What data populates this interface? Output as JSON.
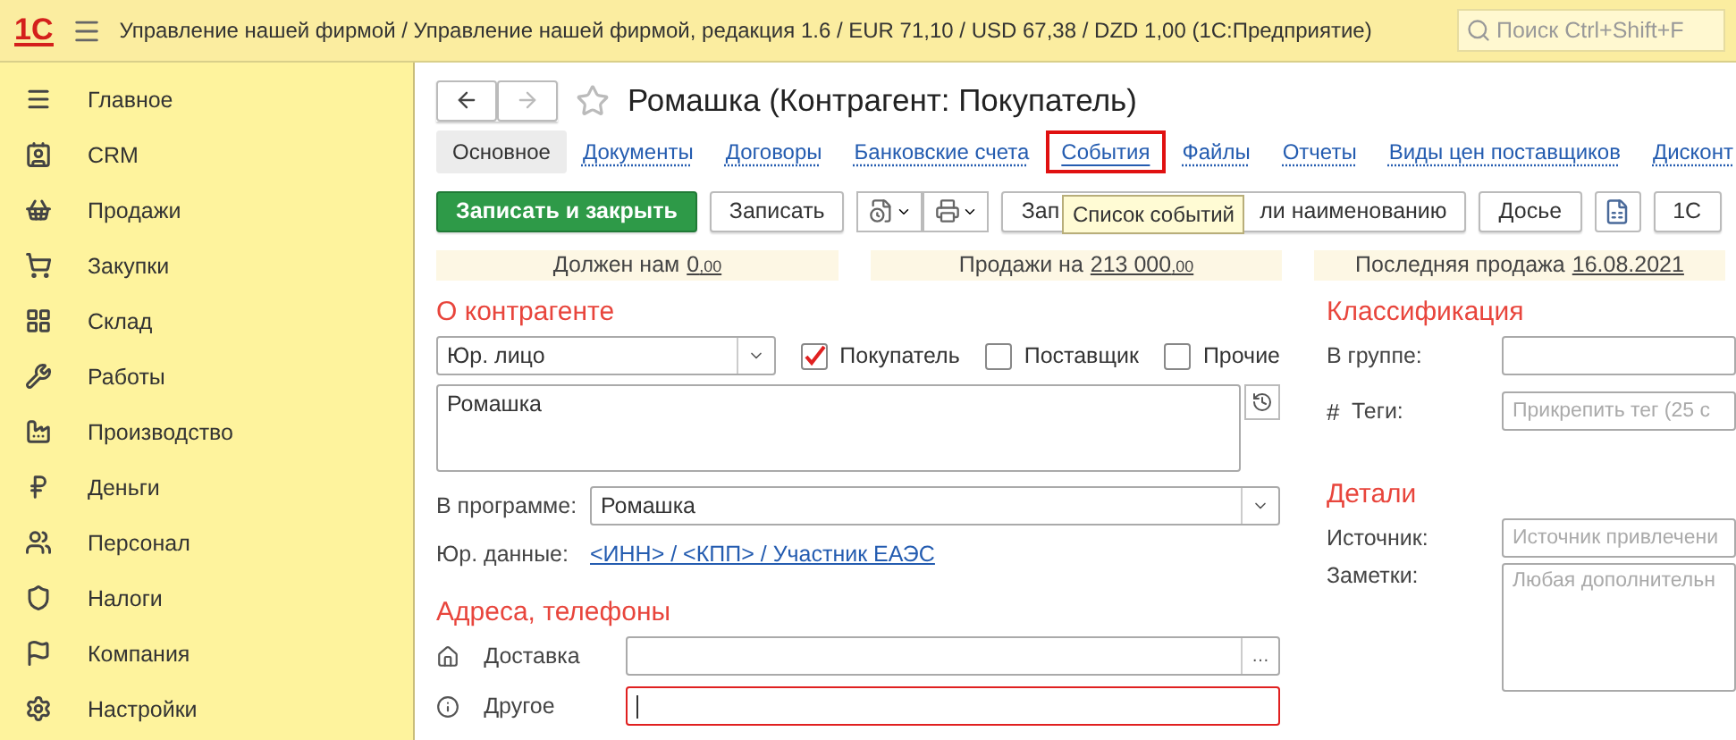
{
  "topbar": {
    "logo": "1С",
    "title": "Управление нашей фирмой / Управление нашей фирмой, редакция 1.6 / EUR 71,10 / USD 67,38 / DZD 1,00  (1С:Предприятие)",
    "search": {
      "placeholder": "Поиск Ctrl+Shift+F"
    }
  },
  "sidebar": {
    "items": [
      {
        "label": "Главное"
      },
      {
        "label": "CRM"
      },
      {
        "label": "Продажи"
      },
      {
        "label": "Закупки"
      },
      {
        "label": "Склад"
      },
      {
        "label": "Работы"
      },
      {
        "label": "Производство"
      },
      {
        "label": "Деньги"
      },
      {
        "label": "Персонал"
      },
      {
        "label": "Налоги"
      },
      {
        "label": "Компания"
      },
      {
        "label": "Настройки"
      }
    ]
  },
  "form": {
    "title": "Ромашка (Контрагент: Покупатель)",
    "tabs": [
      {
        "label": "Основное",
        "selected": true,
        "highlighted": false
      },
      {
        "label": "Документы",
        "selected": false,
        "highlighted": false
      },
      {
        "label": "Договоры",
        "selected": false,
        "highlighted": false
      },
      {
        "label": "Банковские счета",
        "selected": false,
        "highlighted": false
      },
      {
        "label": "События",
        "selected": false,
        "highlighted": true
      },
      {
        "label": "Файлы",
        "selected": false,
        "highlighted": false
      },
      {
        "label": "Отчеты",
        "selected": false,
        "highlighted": false
      },
      {
        "label": "Виды цен поставщиков",
        "selected": false,
        "highlighted": false
      },
      {
        "label": "Дисконт",
        "selected": false,
        "highlighted": false
      }
    ],
    "tooltip": "Список событий",
    "toolbar": [
      {
        "kind": "primary",
        "label": "Записать и закрыть"
      },
      {
        "kind": "text",
        "label": "Записать"
      },
      {
        "kind": "menus"
      },
      {
        "kind": "covered",
        "parts": [
          "Зап",
          "ли наименованию"
        ]
      },
      {
        "kind": "text",
        "label": "Досье"
      },
      {
        "kind": "icon"
      },
      {
        "kind": "text",
        "label": "1С"
      }
    ],
    "info": [
      {
        "label": "Должен нам",
        "value": "0$_{,00}$"
      },
      {
        "label": "Продажи на",
        "value": "213 000$_{,00}$"
      },
      {
        "label": "Последняя продажа",
        "value": "16.08.2021"
      }
    ],
    "about": {
      "heading": "О контрагенте",
      "type": "Юр. лицо",
      "roles": [
        {
          "label": "Покупатель",
          "checked": true
        },
        {
          "label": "Поставщик",
          "checked": false
        },
        {
          "label": "Прочие",
          "checked": false
        }
      ],
      "name": "Ромашка",
      "program_label": "В программе:",
      "program": "Ромашка",
      "legal_label": "Юр. данные:",
      "legal_link": "<ИНН> / <КПП> / Участник ЕАЭС"
    },
    "addresses": {
      "heading": "Адреса, телефоны",
      "rows": [
        {
          "label": "Доставка",
          "focused": false,
          "button": "…"
        },
        {
          "label": "Другое",
          "focused": true
        }
      ]
    },
    "classification": {
      "heading": "Классификация",
      "group_label": "В группе:",
      "tags_prefix": "#",
      "tags_label": "Теги:",
      "tags_placeholder": "Прикрепить тег (25 с"
    },
    "details": {
      "heading": "Детали",
      "source_label": "Источник:",
      "source_placeholder": "Источник привлечени",
      "notes_label": "Заметки:",
      "notes_placeholder": "Любая дополнительн"
    }
  }
}
